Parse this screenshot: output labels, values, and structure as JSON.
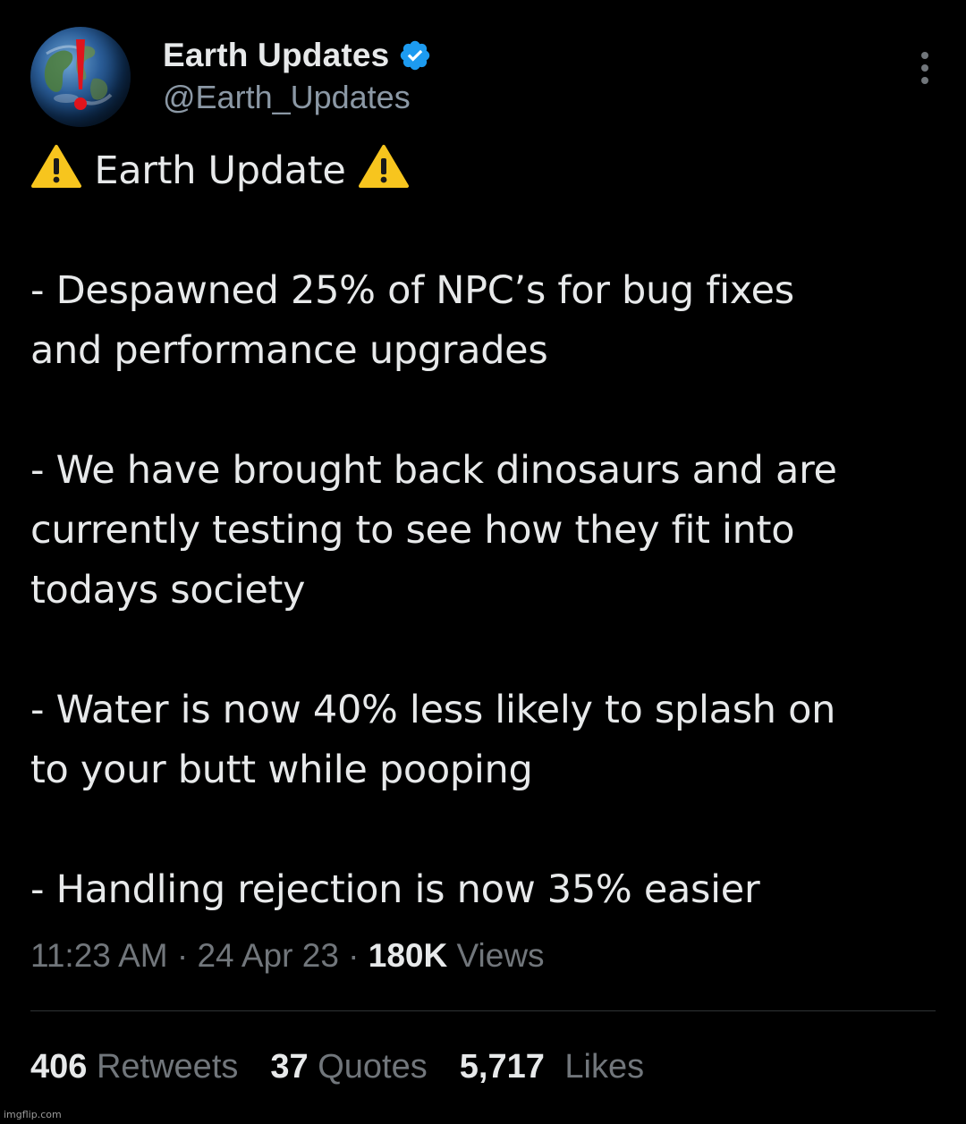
{
  "author": {
    "display_name": "Earth Updates",
    "handle": "@Earth_Updates",
    "verified_icon": "verified-badge-icon"
  },
  "tweet": {
    "title": "Earth Update",
    "lines": [
      "- Despawned 25% of NPC’s for bug fixes",
      "and performance upgrades",
      "- We have brought back dinosaurs and are",
      "currently testing to see how they fit into",
      "todays society",
      "- Water is now 40% less likely to splash on",
      "to your butt while pooping",
      "- Handling rejection is now 35% easier"
    ]
  },
  "meta": {
    "time": "11:23 AM",
    "separator": "·",
    "date": "24 Apr 23",
    "views_count": "180K",
    "views_label": "Views"
  },
  "stats": {
    "retweets_count": "406",
    "retweets_label": "Retweets",
    "quotes_count": "37",
    "quotes_label": "Quotes",
    "likes_count": "5,717",
    "likes_label": "Likes"
  },
  "watermark": "imgflip.com",
  "colors": {
    "background": "#000000",
    "text_primary": "#e7e9ea",
    "text_secondary": "#71767b",
    "verified_blue": "#1d9bf0",
    "warning_yellow": "#f7c51e",
    "avatar_exclamation_red": "#e0141c"
  }
}
